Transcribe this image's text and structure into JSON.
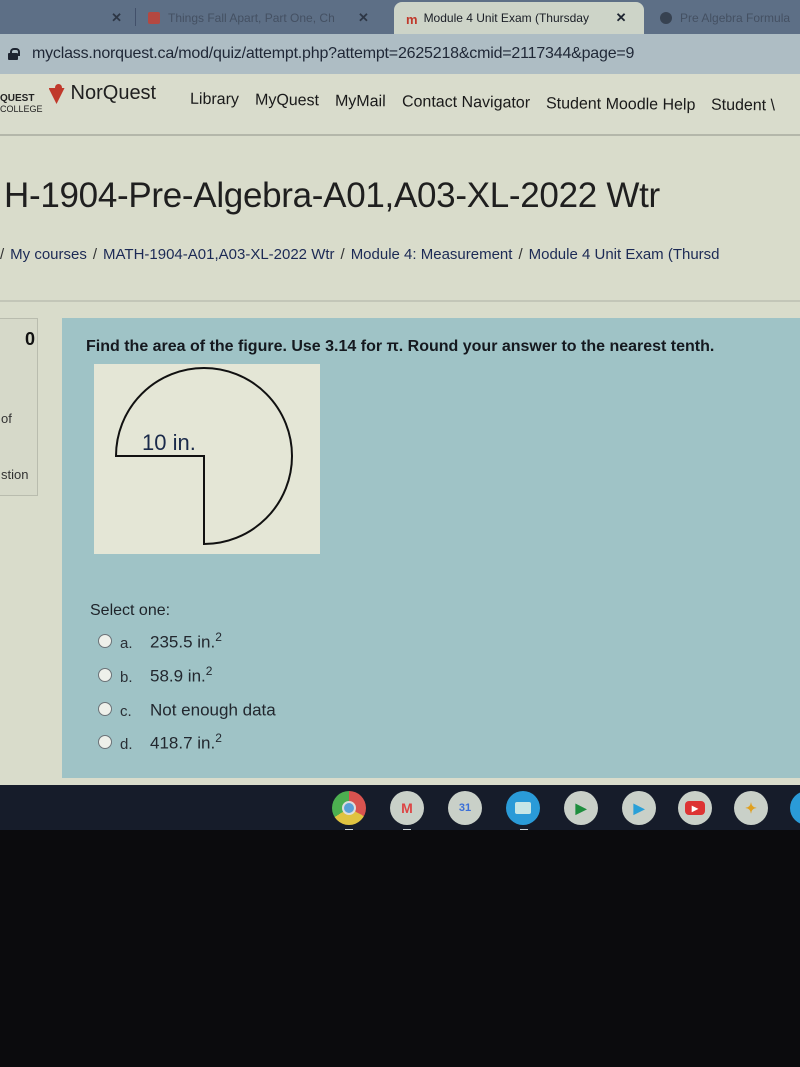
{
  "browser": {
    "tabs": [
      {
        "label": "",
        "state": "inactive"
      },
      {
        "label": "Things Fall Apart, Part One, Ch",
        "state": "inactive",
        "icon": "youtube-icon"
      },
      {
        "label": "Module 4 Unit Exam (Thursday",
        "state": "active",
        "icon": "moodle-icon"
      },
      {
        "label": "Pre Algebra Formula",
        "state": "inactive",
        "icon": "globe-icon"
      }
    ],
    "close_glyph": "✕",
    "url": "myclass.norquest.ca/mod/quiz/attempt.php?attempt=2625218&cmid=2117344&page=9"
  },
  "site": {
    "logo_word": "QUEST",
    "logo_sub": "COLLEGE",
    "logo_name": "NorQuest",
    "nav": [
      "Library",
      "MyQuest",
      "MyMail",
      "Contact Navigator",
      "Student Moodle Help",
      "Student \\"
    ]
  },
  "page": {
    "course_title": "H-1904-Pre-Algebra-A01,A03-XL-2022 Wtr",
    "breadcrumb": [
      "My courses",
      "MATH-1904-A01,A03-XL-2022 Wtr",
      "Module 4: Measurement",
      "Module 4 Unit Exam (Thursd"
    ],
    "breadcrumb_sep": "/"
  },
  "question_info": {
    "number": "0",
    "line1": "of",
    "line2": "stion"
  },
  "question": {
    "text": "Find the area of the figure. Use 3.14 for π. Round your answer to the nearest tenth.",
    "figure_label": "10 in.",
    "figure_description": "three-quarter circle with radius 10 in.",
    "select_label": "Select one:",
    "options": [
      {
        "letter": "a.",
        "value": "235.5 in.",
        "sup": "2"
      },
      {
        "letter": "b.",
        "value": "58.9 in.",
        "sup": "2"
      },
      {
        "letter": "c.",
        "value": "Not enough data",
        "sup": ""
      },
      {
        "letter": "d.",
        "value": "418.7 in.",
        "sup": "2"
      }
    ]
  },
  "shelf": {
    "apps": [
      "Chrome",
      "Gmail",
      "Calendar",
      "Files",
      "Meet",
      "Play Store",
      "YouTube",
      "Photos"
    ],
    "calendar_day": "31"
  }
}
